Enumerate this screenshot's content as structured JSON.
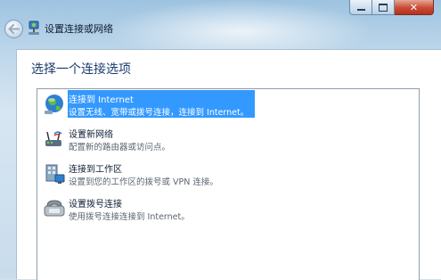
{
  "window": {
    "title": "设置连接或网络",
    "caption": {
      "close_glyph": "✕"
    }
  },
  "content": {
    "heading": "选择一个连接选项",
    "options": [
      {
        "title": "连接到 Internet",
        "description": "设置无线、宽带或拨号连接，连接到 Internet。",
        "icon": "globe-network-icon",
        "selected": true
      },
      {
        "title": "设置新网络",
        "description": "配置新的路由器或访问点。",
        "icon": "router-icon",
        "selected": false
      },
      {
        "title": "连接到工作区",
        "description": "设置到您的工作区的拨号或 VPN 连接。",
        "icon": "workplace-icon",
        "selected": false
      },
      {
        "title": "设置拨号连接",
        "description": "使用拨号连接连接到 Internet。",
        "icon": "phone-modem-icon",
        "selected": false
      }
    ]
  },
  "colors": {
    "selection": "#3399ff",
    "heading": "#1a3c6e"
  }
}
